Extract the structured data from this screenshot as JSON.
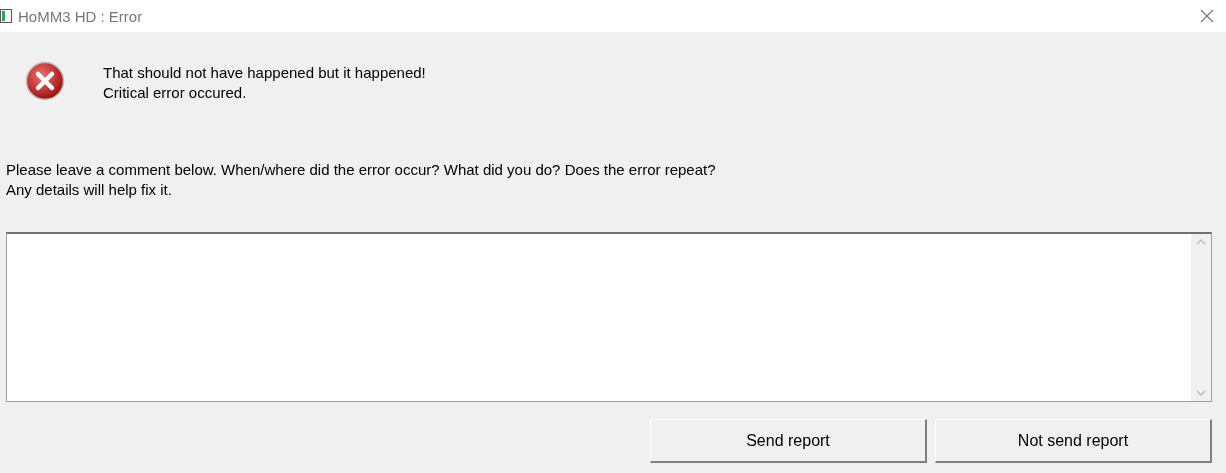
{
  "window": {
    "title": "HoMM3 HD : Error"
  },
  "message": [
    "That should not have happened but it happened!",
    "Critical error occured."
  ],
  "prompt": [
    "Please leave a comment below. When/where did the error occur? What did you do? Does the error repeat?",
    "Any details will help fix it."
  ],
  "buttons": [
    "Send report",
    "Not send report"
  ]
}
